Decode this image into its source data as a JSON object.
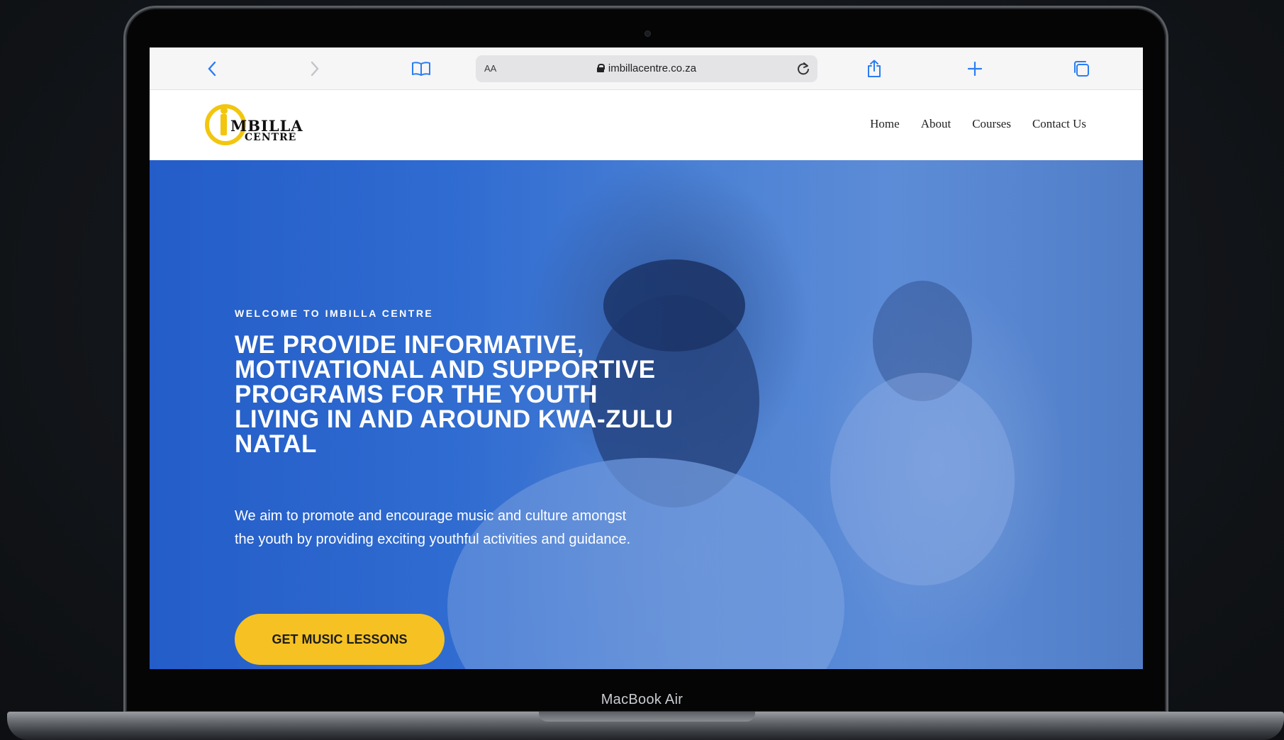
{
  "device": {
    "label": "MacBook Air"
  },
  "browser": {
    "text_size_label": "AA",
    "url": "imbillacentre.co.za"
  },
  "site": {
    "logo": {
      "word1": "MBILLA",
      "word2": "CENTRE",
      "brand_color": "#f2c60f"
    },
    "nav": [
      "Home",
      "About",
      "Courses",
      "Contact Us"
    ],
    "hero": {
      "eyebrow": "WELCOME TO IMBILLA CENTRE",
      "headline": "WE PROVIDE INFORMATIVE, MOTIVATIONAL AND SUPPORTIVE PROGRAMS FOR THE YOUTH LIVING IN AND AROUND KWA-ZULU NATAL",
      "description": "We aim to promote and encourage music and culture amongst the youth by providing exciting youthful activities and guidance.",
      "cta_label": "GET MUSIC LESSONS",
      "cta_color": "#f6c223",
      "overlay_color": "#1b56c8"
    }
  }
}
